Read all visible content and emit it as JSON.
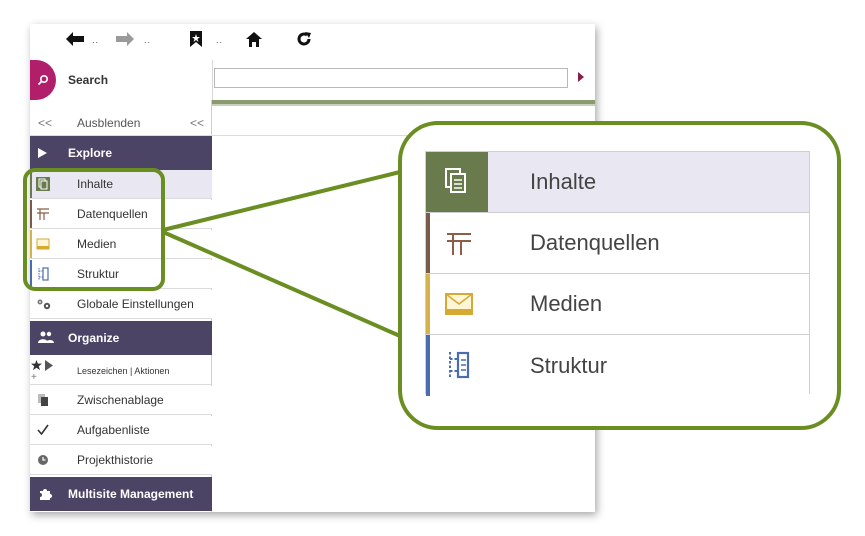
{
  "toolbar": {
    "back_dots": "..",
    "forward_dots": "..",
    "bookmark_dots": ".."
  },
  "search": {
    "label": "Search",
    "value": ""
  },
  "sidebar": {
    "hide_label": "Ausblenden",
    "hide_left_glyph": "<<",
    "hide_right_glyph": "<<",
    "explore": {
      "title": "Explore",
      "items": [
        {
          "label": "Inhalte",
          "icon": "content-icon",
          "accent": "#697a4d"
        },
        {
          "label": "Datenquellen",
          "icon": "datasource-icon",
          "accent": "#7a5a4a"
        },
        {
          "label": "Medien",
          "icon": "media-icon",
          "accent": "#d6b24a"
        },
        {
          "label": "Struktur",
          "icon": "structure-icon",
          "accent": "#4a6db0"
        },
        {
          "label": "Globale Einstellungen",
          "icon": "gears-icon",
          "accent": ""
        }
      ]
    },
    "organize": {
      "title": "Organize",
      "bookmarks_label": "Lesezeichen | Aktionen",
      "items": [
        {
          "label": "Zwischenablage",
          "icon": "clipboard-icon"
        },
        {
          "label": "Aufgabenliste",
          "icon": "checkmark-icon"
        },
        {
          "label": "Projekthistorie",
          "icon": "clock-icon"
        }
      ]
    },
    "multisite": {
      "title": "Multisite Management"
    }
  },
  "zoomed": {
    "items": [
      {
        "label": "Inhalte"
      },
      {
        "label": "Datenquellen"
      },
      {
        "label": "Medien"
      },
      {
        "label": "Struktur"
      }
    ]
  },
  "colors": {
    "section_bg": "#4b4465",
    "brand_magenta": "#b11f6a",
    "callout_green": "#6b8e23",
    "active_bg": "#e9e7f1"
  }
}
